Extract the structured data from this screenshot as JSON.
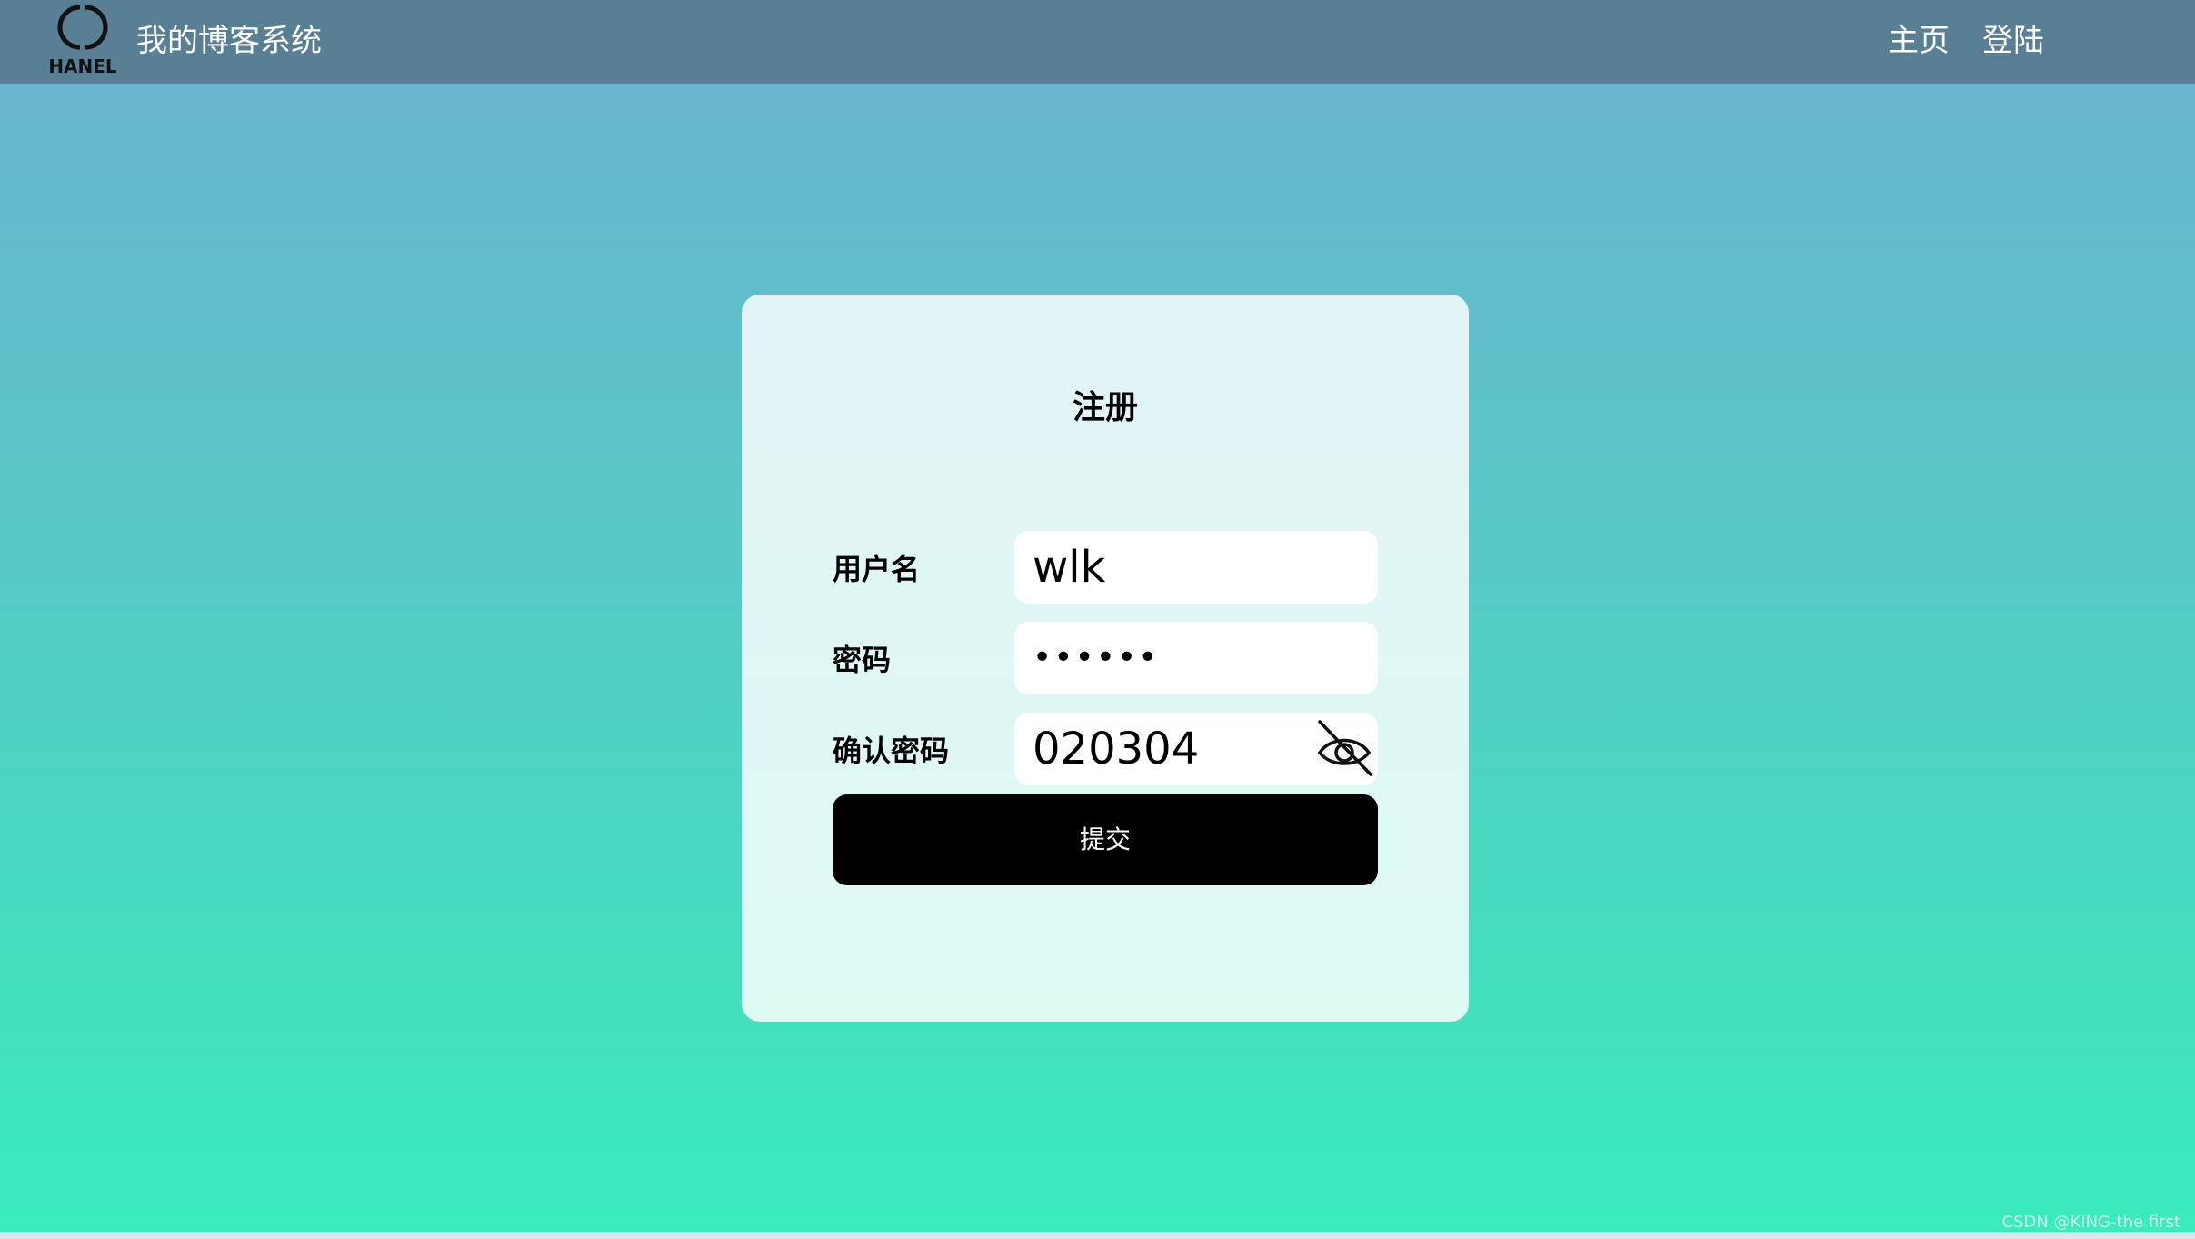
{
  "navbar": {
    "logo_text": "HANEL",
    "title": "我的博客系统",
    "links": [
      {
        "label": "主页"
      },
      {
        "label": "登陆"
      }
    ]
  },
  "register": {
    "title": "注册",
    "fields": [
      {
        "label": "用户名",
        "value": "wlk"
      },
      {
        "label": "密码",
        "value": "••••••"
      },
      {
        "label": "确认密码",
        "value": "020304"
      }
    ],
    "submit_label": "提交"
  },
  "watermark": "CSDN @KING-the first",
  "icons": {
    "logo": "chanel-logo-icon",
    "password_toggle": "eye-off-icon"
  },
  "colors": {
    "navbar": "#587f94",
    "button": "#000000",
    "gradient_top": "#6bb2d1",
    "gradient_bottom": "#39ecbb"
  }
}
